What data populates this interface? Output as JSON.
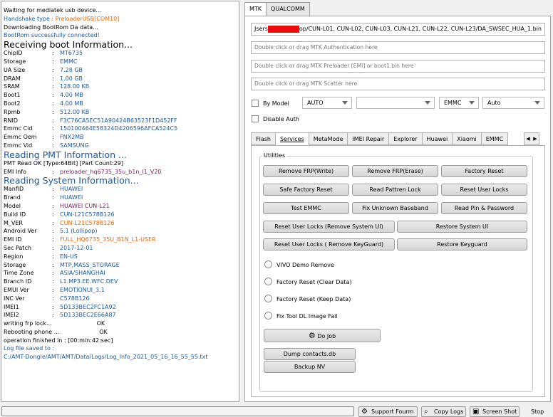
{
  "log": {
    "lines": {
      "l1": "Waiting for mediatek usb device...",
      "l2": "Handshake type : PreloaderUSB[COM10]",
      "l3": "Downloading BootRom Da data...",
      "l4": "BootRom successfully connected!",
      "h1": "Receiving boot Information...",
      "chip_k": "ChipID",
      "chip_v": "MT6735",
      "storage_k": "Storage",
      "storage_v": "EMMC",
      "ua_k": "UA Size",
      "ua_v": "7.28 GB",
      "dram_k": "DRAM",
      "dram_v": "1.00 GB",
      "sram_k": "SRAM",
      "sram_v": "128.00 KB",
      "boot1_k": "Boot1",
      "boot1_v": "4.00 MB",
      "boot2_k": "Boot2",
      "boot2_v": "4.00 MB",
      "rpmb_k": "Rpmb",
      "rpmb_v": "512.00 KB",
      "rnid_k": "RNID",
      "rnid_v": "F3C76CA5EC51A90424B63523F1D452FF",
      "ecid_k": "Emmc Cid",
      "ecid_v": "150100464E58324D4206596AFCA524C5",
      "eoem_k": "Emmc Oem",
      "eoem_v": "FNX2MB",
      "evid_k": "Emmc Vid",
      "evid_v": "SAMSUNG",
      "h2": "Reading PMT Information ...",
      "pmt": "PMT Read OK [Type:64Bit] [Part Count:29]",
      "emi_k": "EMI Info",
      "emi_v": "preloader_hq6735_35u_b1n_l1_V20",
      "h3": "Reading System Information...",
      "manf_k": "ManfID",
      "manf_v": "HUAWEI",
      "brand_k": "Brand",
      "brand_v": "HUAWEI",
      "model_k": "Model",
      "model_v": "HUAWEI CUN-L21",
      "build_k": "Build ID",
      "build_v": "CUN-L21C578B126",
      "mver_k": "M_VER",
      "mver_v": "CUN-L21C578B126",
      "andr_k": "Android Ver",
      "andr_v": "5.1 (Lollipop)",
      "emiid_k": "EMI ID",
      "emiid_v": "FULL_HQ6735_35U_B1N_L1-USER",
      "patch_k": "Sec Patch",
      "patch_v": "2017-12-01",
      "region_k": "Region",
      "region_v": "EN-US",
      "stor2_k": "Storage",
      "stor2_v": "MTP,MASS_STORAGE",
      "tz_k": "Time Zone",
      "tz_v": "ASIA/SHANGHAI",
      "branch_k": "Branch ID",
      "branch_v": "L1.MP3.EE.WFC.DEV",
      "emui_k": "EMUI Ver",
      "emui_v": "EMOTIONUI_3.1",
      "inc_k": "INC Ver",
      "inc_v": "C578B126",
      "imei1_k": "IMEI1",
      "imei1_v": "5D133BEC2FC1A92",
      "imei2_k": "IMEI2",
      "imei2_v": "5D133BEC2E66A87",
      "frp": "writing frp lock...",
      "frp_ok": "OK",
      "reboot": "Rebooting phone ...",
      "reboot_ok": "OK",
      "finished": "operation finished in : [00:min:42:sec]",
      "saved": "Log file saved to :",
      "path": "C:/AMT-Dongle/AMT/AMT/Data/Logs/Log_Info_2021_05_16_16_55_55.txt"
    }
  },
  "tabs_top": [
    "MTK",
    "QUALCOMM"
  ],
  "fields": {
    "da_prefix": "Jsers",
    "da_suffix": "op/CUN-L01, CUN-L02, CUN-L03, CUN-L21, CUN-L22, CUN-L23/DA_SWSEC_HUA_1.bin",
    "auth_placeholder": "Double click or drag MTK Authentication here",
    "preloader_placeholder": "Double click or drag MTK Preloader [EMI] or boot1.bin here",
    "scatter_placeholder": "Double click or drag MTK Scatter here"
  },
  "options": {
    "by_model": "By Model",
    "combo_auto": "AUTO",
    "combo_emmc": "EMMC",
    "combo_auto2": "Auto",
    "disable_auth": "Disable Auth"
  },
  "subtabs": [
    "Flash",
    "Services",
    "MetaMode",
    "IMEI Repair",
    "Explorer",
    "Huawei",
    "Xiaomi",
    "EMMC"
  ],
  "utilities": {
    "title": "Utilities",
    "buttons": {
      "remove_frp_write": "Remove FRP(Write)",
      "remove_frp_erase": "Remove FRP(Erase)",
      "factory_reset": "Factory Reset",
      "safe_factory_reset": "Safe Factory Reset",
      "read_pattren_lock": "Read Pattren Lock",
      "reset_user_locks": "Reset User Locks",
      "test_emmc": "Test EMMC",
      "fix_unknown_baseband": "Fix Unknown Baseband",
      "read_pin_password": "Read Pin & Password",
      "reset_user_locks_system_ui": "Reset User Locks (Remove System UI)",
      "restore_system_ui": "Restore System UI",
      "reset_user_locks_keyguard": "Reset User Locks ( Remove KeyGuard)",
      "restore_keyguard": "Restore Keyguard",
      "do_job": "Do Job",
      "dump_contacts": "Dump contacts.db",
      "backup_nv": "Backup NV"
    },
    "radios": {
      "vivo_demo": "VIVO Demo Remove",
      "factory_clear": "Factory Reset (Clear Data)",
      "factory_keep": "Factory Reset (Keep Data)",
      "fix_tool_dl": "Fix Tool DL Image Fail"
    }
  },
  "statusbar": {
    "support_forum": "Support Fourm",
    "copy_logs": "Copy Logs",
    "screen_shot": "Screen Shot",
    "stop": "Stop"
  },
  "colors": {
    "log_blue": "#1a5aa0",
    "log_orange": "#e06a10",
    "redaction": "#ee0a0a"
  }
}
